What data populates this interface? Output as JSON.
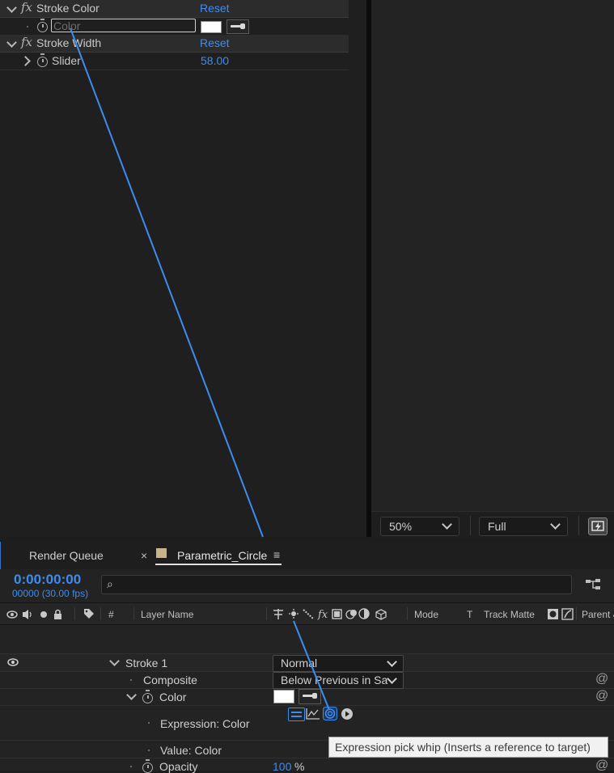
{
  "effect_controls": {
    "stroke_color": {
      "fx": "fx",
      "name": "Stroke Color",
      "reset": "Reset",
      "property": "Color"
    },
    "stroke_width": {
      "fx": "fx",
      "name": "Stroke Width",
      "reset": "Reset",
      "property": "Slider",
      "value": "58.00"
    }
  },
  "viewer": {
    "zoom": "50%",
    "resolution": "Full"
  },
  "timeline": {
    "tabs": {
      "render_queue": "Render Queue",
      "close": "×",
      "comp": "Parametric_Circle",
      "menu": "≡"
    },
    "timecode": "0:00:00:00",
    "frame_info": "00000 (30.00 fps)",
    "search_glyph": "⌕",
    "columns": {
      "num": "#",
      "layer_name": "Layer Name",
      "mode": "Mode",
      "t": "T",
      "track_matte": "Track Matte",
      "parent": "Parent &"
    },
    "rows": {
      "stroke1": {
        "name": "Stroke 1",
        "mode": "Normal"
      },
      "composite": {
        "name": "Composite",
        "value": "Below Previous in Sa"
      },
      "color": {
        "name": "Color"
      },
      "expression": {
        "name": "Expression: Color"
      },
      "value_color": {
        "name": "Value: Color"
      },
      "opacity": {
        "name": "Opacity",
        "value": "100",
        "unit": "%"
      }
    },
    "tooltip": "Expression pick whip (Inserts a reference to target)"
  },
  "colors": {
    "accent_blue": "#3d8cf0",
    "panel_bg": "#1f1f1f",
    "swatch": "#ffffff"
  }
}
